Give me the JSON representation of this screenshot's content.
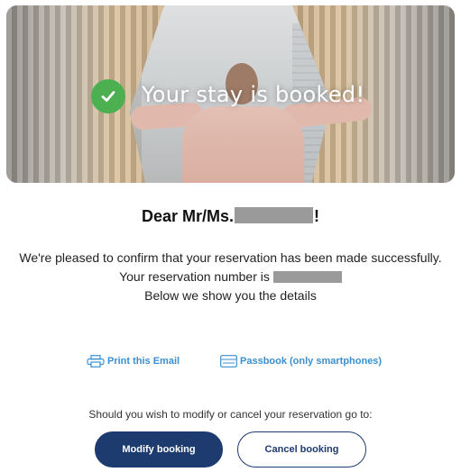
{
  "hero": {
    "title": "Your stay is booked!",
    "check_icon": "check-circle-icon",
    "accent_color": "#4caf50"
  },
  "greeting": {
    "prefix": "Dear Mr/Ms.",
    "suffix": "!"
  },
  "message": {
    "line1": "We're pleased to confirm that your reservation has been made successfully.",
    "line2": "Your reservation number is",
    "line3": "Below we show you the details"
  },
  "links": {
    "print_label": "Print this Email",
    "print_icon": "printer-icon",
    "passbook_label": "Passbook (only smartphones)",
    "passbook_icon": "passbook-icon",
    "color": "#3a8fd0"
  },
  "modify": {
    "prompt": "Should you wish to modify or cancel your reservation go to:",
    "modify_label": "Modify booking",
    "cancel_label": "Cancel booking",
    "brand_color": "#1d3b6e"
  }
}
